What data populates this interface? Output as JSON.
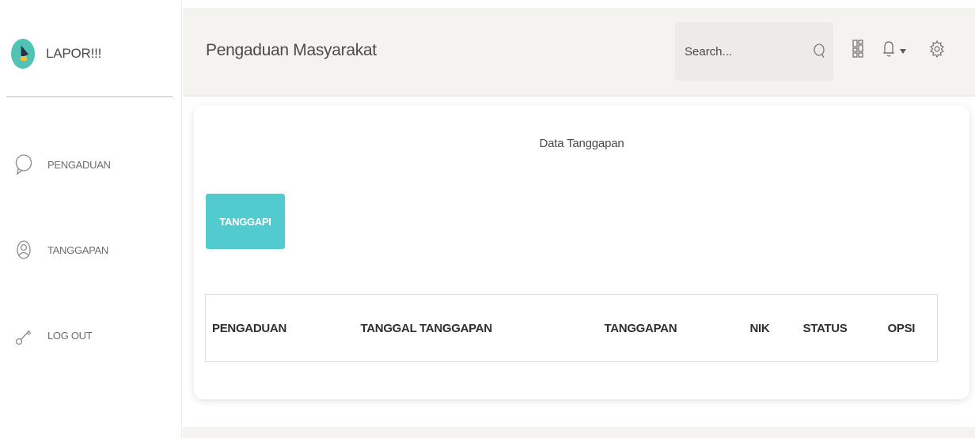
{
  "brand": {
    "name": "LAPOR!!!",
    "logo": "megaphone-logo"
  },
  "sidebar": {
    "items": [
      {
        "label": "PENGADUAN",
        "icon": "chat-bubble-icon"
      },
      {
        "label": "TANGGAPAN",
        "icon": "user-circle-icon"
      },
      {
        "label": "LOG OUT",
        "icon": "key-icon"
      }
    ]
  },
  "header": {
    "title": "Pengaduan Masyarakat",
    "search_placeholder": "Search...",
    "icons": [
      "search-icon",
      "grid-icon",
      "bell-icon",
      "settings-gear-icon"
    ]
  },
  "card": {
    "title": "Data Tanggapan",
    "button_label": "TANGGAPI",
    "columns": [
      "PENGADUAN",
      "TANGGAL TANGGAPAN",
      "TANGGAPAN",
      "NIK",
      "STATUS",
      "OPSI"
    ]
  },
  "colors": {
    "accent": "#51cbce",
    "header_bg": "#f4f3ef",
    "logo_bg": "#4fc4b5"
  }
}
